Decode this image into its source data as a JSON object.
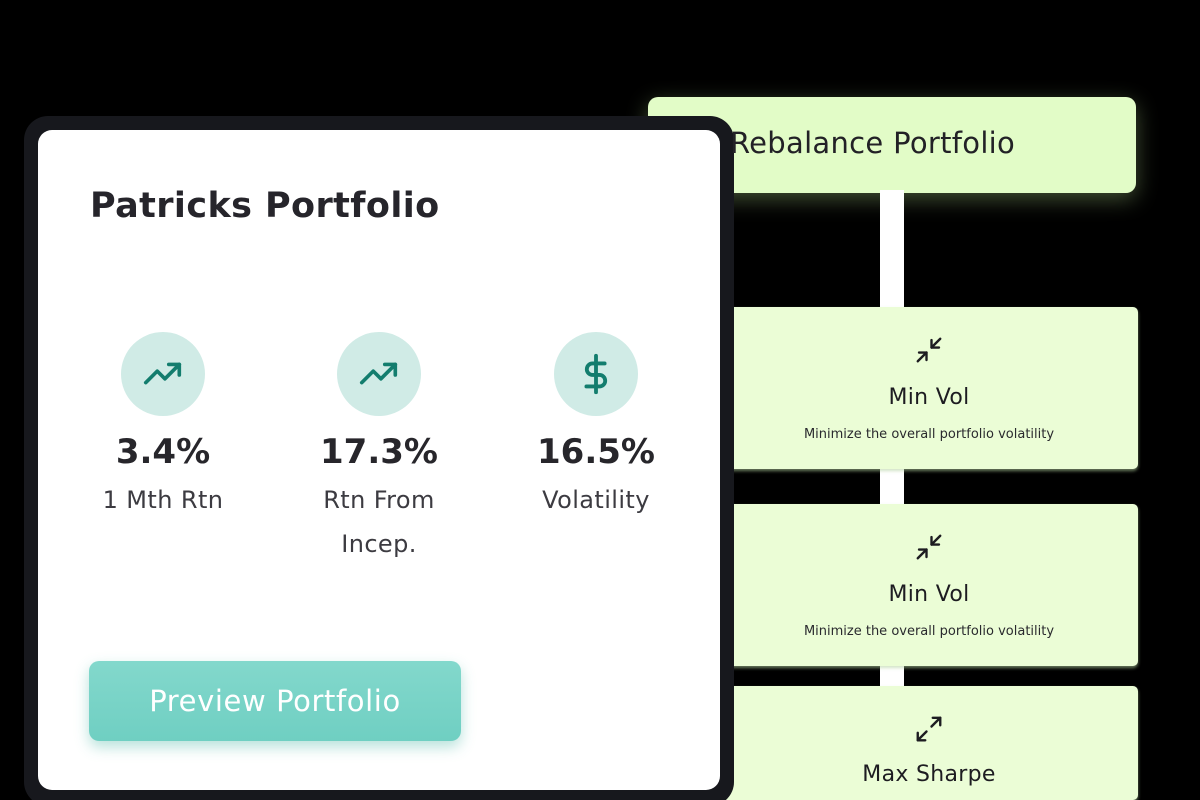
{
  "portfolio": {
    "title": "Patricks Portfolio",
    "metrics": [
      {
        "icon": "trending-up-icon",
        "value": "3.4%",
        "label": "1 Mth Rtn"
      },
      {
        "icon": "trending-up-icon",
        "value": "17.3%",
        "label": "Rtn From Incep."
      },
      {
        "icon": "dollar-icon",
        "value": "16.5%",
        "label": "Volatility"
      }
    ],
    "preview_button": "Preview Portfolio"
  },
  "rebalance": {
    "title": "Rebalance Portfolio",
    "strategies": [
      {
        "icon": "minimize-arrows-icon",
        "name": "Min Vol",
        "description": "Minimize the overall portfolio volatility"
      },
      {
        "icon": "minimize-arrows-icon",
        "name": "Min Vol",
        "description": "Minimize the overall portfolio volatility"
      },
      {
        "icon": "maximize-arrows-icon",
        "name": "Max Sharpe"
      }
    ]
  },
  "colors": {
    "accent_teal": "#137d6e",
    "icon_circle": "#d0ebe6",
    "button_teal": "#75d2c5",
    "strategy_green": "#ebfdd6",
    "header_green": "#e2fcc7",
    "background": "#000000"
  }
}
